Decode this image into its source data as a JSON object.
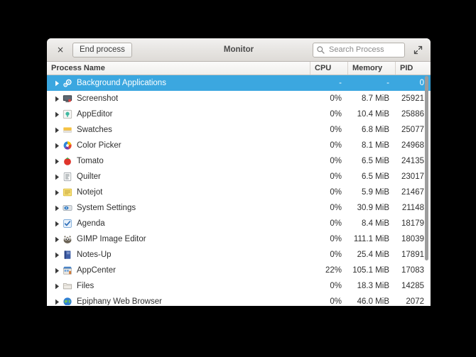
{
  "window": {
    "title": "Monitor",
    "close_label": "×",
    "end_process_label": "End process",
    "expand_icon": "expand-icon",
    "close_icon": "close-icon"
  },
  "search": {
    "placeholder": "Search Process",
    "value": "",
    "icon": "search-icon"
  },
  "columns": [
    {
      "key": "name",
      "label": "Process Name"
    },
    {
      "key": "cpu",
      "label": "CPU"
    },
    {
      "key": "memory",
      "label": "Memory"
    },
    {
      "key": "pid",
      "label": "PID"
    }
  ],
  "colors": {
    "selection": "#3ba7e0",
    "titlebar_top": "#f2f1f0",
    "titlebar_bottom": "#dedbd7",
    "row_text": "#2f2f2f",
    "header_text": "#3c3c3c"
  },
  "rows": [
    {
      "name": "Background Applications",
      "cpu": "-",
      "memory": "-",
      "pid": "0",
      "icon": "gears-icon",
      "selected": true
    },
    {
      "name": "Screenshot",
      "cpu": "0%",
      "memory": "8.7 MiB",
      "pid": "25921",
      "icon": "screenshot-icon",
      "selected": false
    },
    {
      "name": "AppEditor",
      "cpu": "0%",
      "memory": "10.4 MiB",
      "pid": "25886",
      "icon": "appeditor-icon",
      "selected": false
    },
    {
      "name": "Swatches",
      "cpu": "0%",
      "memory": "6.8 MiB",
      "pid": "25077",
      "icon": "swatches-icon",
      "selected": false
    },
    {
      "name": "Color Picker",
      "cpu": "0%",
      "memory": "8.1 MiB",
      "pid": "24968",
      "icon": "colorpicker-icon",
      "selected": false
    },
    {
      "name": "Tomato",
      "cpu": "0%",
      "memory": "6.5 MiB",
      "pid": "24135",
      "icon": "tomato-icon",
      "selected": false
    },
    {
      "name": "Quilter",
      "cpu": "0%",
      "memory": "6.5 MiB",
      "pid": "23017",
      "icon": "quilter-icon",
      "selected": false
    },
    {
      "name": "Notejot",
      "cpu": "0%",
      "memory": "5.9 MiB",
      "pid": "21467",
      "icon": "notejot-icon",
      "selected": false
    },
    {
      "name": "System Settings",
      "cpu": "0%",
      "memory": "30.9 MiB",
      "pid": "21148",
      "icon": "settings-icon",
      "selected": false
    },
    {
      "name": "Agenda",
      "cpu": "0%",
      "memory": "8.4 MiB",
      "pid": "18179",
      "icon": "agenda-icon",
      "selected": false
    },
    {
      "name": "GIMP Image Editor",
      "cpu": "0%",
      "memory": "111.1 MiB",
      "pid": "18039",
      "icon": "gimp-icon",
      "selected": false
    },
    {
      "name": "Notes-Up",
      "cpu": "0%",
      "memory": "25.4 MiB",
      "pid": "17891",
      "icon": "notesup-icon",
      "selected": false
    },
    {
      "name": "AppCenter",
      "cpu": "22%",
      "memory": "105.1 MiB",
      "pid": "17083",
      "icon": "appcenter-icon",
      "selected": false
    },
    {
      "name": "Files",
      "cpu": "0%",
      "memory": "18.3 MiB",
      "pid": "14285",
      "icon": "files-icon",
      "selected": false
    },
    {
      "name": "Epiphany Web Browser",
      "cpu": "0%",
      "memory": "46.0 MiB",
      "pid": "2072",
      "icon": "epiphany-icon",
      "selected": false
    }
  ]
}
